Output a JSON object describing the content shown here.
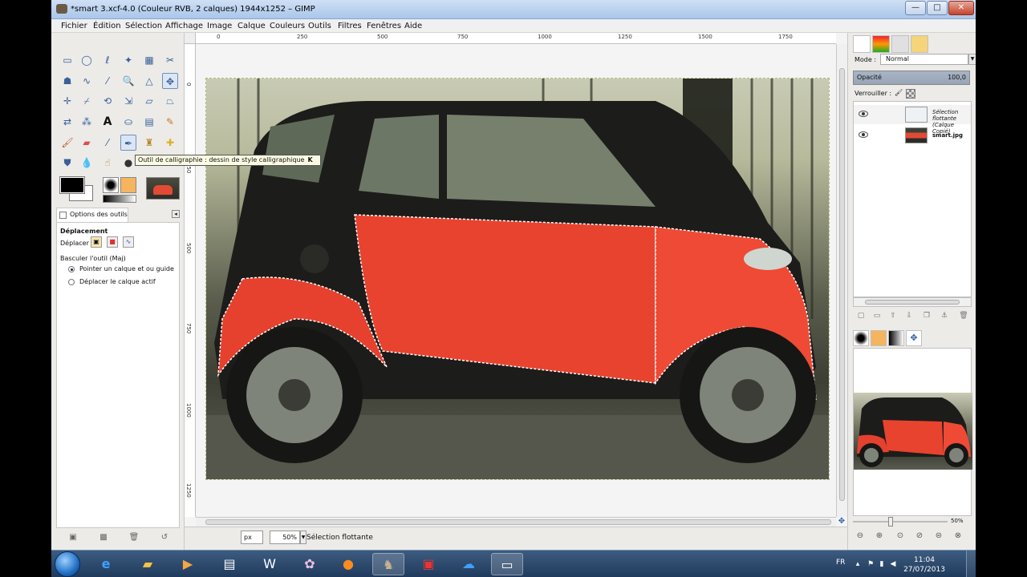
{
  "window": {
    "title": "*smart 3.xcf-4.0 (Couleur RVB, 2 calques) 1944x1252 – GIMP",
    "minimize": "—",
    "maximize": "□",
    "close": "✕"
  },
  "menu": [
    "Fichier",
    "Édition",
    "Sélection",
    "Affichage",
    "Image",
    "Calque",
    "Couleurs",
    "Outils",
    "Filtres",
    "Fenêtres",
    "Aide"
  ],
  "tooltip": {
    "text": "Outil de calligraphie : dessin de style calligraphique",
    "shortcut": "K"
  },
  "tool_options": {
    "tab_label": "Options des outils",
    "heading": "Déplacement",
    "move_label": "Déplacer :",
    "toggle_label": "Basculer l'outil  (Maj)",
    "radio_1": "Pointer un calque et ou guide",
    "radio_2": "Déplacer le calque actif",
    "selected_radio": 1
  },
  "rulers": {
    "top": [
      "0",
      "250",
      "500",
      "750",
      "1000",
      "1250",
      "1500",
      "1750"
    ],
    "left": [
      "0",
      "250",
      "500",
      "750",
      "1000",
      "1250"
    ]
  },
  "status": {
    "unit": "px",
    "zoom": "50%",
    "text": "Sélection flottante"
  },
  "layers": {
    "mode_label": "Mode :",
    "mode_value": "Normal",
    "opacity_label": "Opacité",
    "opacity_value": "100,0",
    "lock_label": "Verrouiller :",
    "items": [
      {
        "name": "Sélection flottante",
        "sub": "(Calque Copié)",
        "italic": true
      },
      {
        "name": "smart.jpg",
        "sub": "",
        "italic": false
      }
    ]
  },
  "navigation": {
    "zoom_value": "50%"
  },
  "taskbar": {
    "lang": "FR",
    "time": "11:04",
    "date": "27/07/2013"
  },
  "colors": {
    "car_red": "#e8432f",
    "titlebar": "#a9c6ea",
    "taskbar": "#1f3a5c"
  }
}
